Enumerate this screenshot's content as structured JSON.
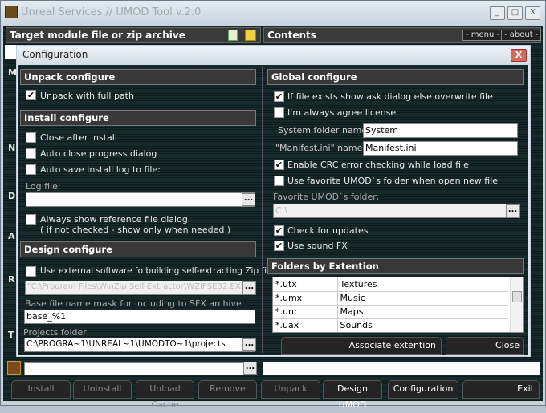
{
  "window": {
    "title": "Unreal Services // UMOD Tool v.2.0",
    "minimize": "_",
    "maximize": "□",
    "close": "X"
  },
  "main": {
    "target_header": "Target module file or zip archive",
    "contents_header": "Contents",
    "menu_label": "- menu -",
    "about_label": "- about -",
    "side_letters": [
      "M",
      "N",
      "D",
      "A",
      "R",
      "T"
    ]
  },
  "dialog": {
    "title": "Configuration",
    "close": "X",
    "unpack": {
      "header": "Unpack configure",
      "full_path": {
        "label": "Unpack with full path",
        "checked": true
      }
    },
    "install": {
      "header": "Install configure",
      "close_after": {
        "label": "Close after install",
        "checked": false
      },
      "auto_close": {
        "label": "Auto close progress dialog",
        "checked": false
      },
      "auto_save": {
        "label": "Auto save install log to file:",
        "checked": false
      },
      "log_file_label": "Log file:",
      "log_file_value": "",
      "always_show": {
        "label": "Always show reference file dialog.",
        "note": "( if not checked - show only when needed )",
        "checked": false
      }
    },
    "design": {
      "header": "Design configure",
      "external": {
        "label": "Use external software fo building self-extracting Zip files",
        "checked": false
      },
      "external_path": "\"C:\\Program Files\\WinZip Self-Extractor\\WZIPSE32.EXE\"",
      "mask_label": "Base file name mask for including to SFX archive",
      "mask_value": "base_%1",
      "projects_label": "Projects folder:",
      "projects_value": "C:\\PROGRA~1\\UNREAL~1\\UMODTO~1\\projects"
    },
    "global": {
      "header": "Global configure",
      "ask_dialog": {
        "label": "If file exists show ask dialog else overwrite file",
        "checked": true
      },
      "agree": {
        "label": "I'm always agree license",
        "checked": false
      },
      "system_label": "System folder name:",
      "system_value": "System",
      "manifest_label": "\"Manifest.ini\" named:",
      "manifest_value": "Manifest.ini",
      "crc": {
        "label": "Enable CRC error checking while load file",
        "checked": true
      },
      "favorite": {
        "label": "Use favorite UMOD`s folder when open new file",
        "checked": false
      },
      "fav_folder_label": "Favorite UMOD`s folder:",
      "fav_folder_value": "C:\\",
      "updates": {
        "label": "Check for updates",
        "checked": true
      },
      "sound": {
        "label": "Use sound FX",
        "checked": true
      }
    },
    "folders": {
      "header": "Folders by Extention",
      "rows": [
        [
          "*.utx",
          "Textures"
        ],
        [
          "*.umx",
          "Music"
        ],
        [
          "*.unr",
          "Maps"
        ],
        [
          "*.uax",
          "Sounds"
        ]
      ]
    },
    "associate": "Associate extention",
    "close_button": "Close"
  },
  "browse": "...",
  "toolbar": [
    {
      "label": "Install",
      "enabled": false
    },
    {
      "label": "Uninstall",
      "enabled": false
    },
    {
      "label": "Unload Cache",
      "enabled": false
    },
    {
      "label": "Remove",
      "enabled": false
    },
    {
      "label": "Unpack",
      "enabled": false
    },
    {
      "label": "Design UMOD",
      "enabled": true
    },
    {
      "label": "Configuration",
      "enabled": true
    },
    {
      "label": "Exit",
      "enabled": true
    }
  ]
}
